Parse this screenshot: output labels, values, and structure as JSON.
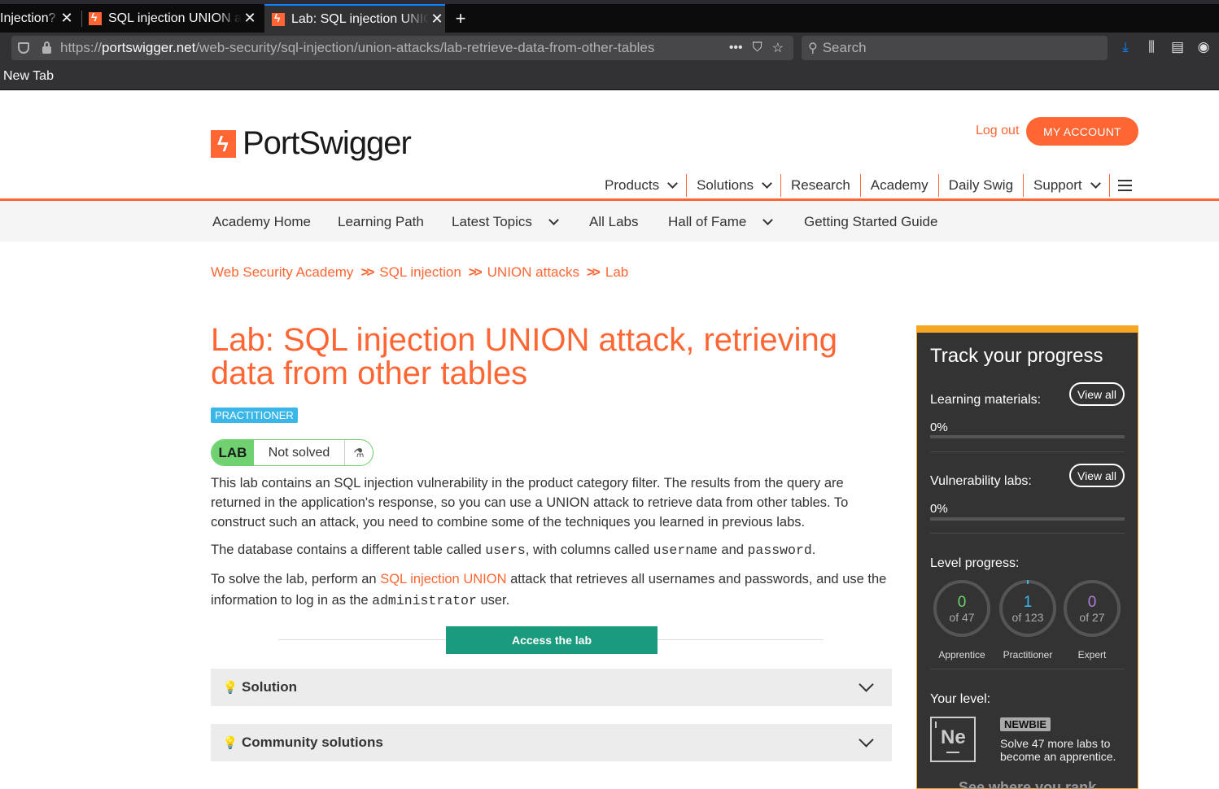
{
  "browser": {
    "tabs": [
      {
        "title": "Injection?",
        "active": false
      },
      {
        "title": "SQL injection UNION attacks",
        "active": false
      },
      {
        "title": "Lab: SQL injection UNION attack",
        "active": true
      }
    ],
    "url_scheme": "https://",
    "url_host": "portswigger.net",
    "url_path": "/web-security/sql-injection/union-attacks/lab-retrieve-data-from-other-tables",
    "search_placeholder": "Search",
    "bookmark": "New Tab"
  },
  "site": {
    "logo_text": "PortSwigger",
    "logout": "Log out",
    "my_account": "MY ACCOUNT",
    "nav": [
      "Products",
      "Solutions",
      "Research",
      "Academy",
      "Daily Swig",
      "Support"
    ],
    "subnav": [
      "Academy Home",
      "Learning Path",
      "Latest Topics",
      "All Labs",
      "Hall of Fame",
      "Getting Started Guide"
    ],
    "breadcrumbs": [
      "Web Security Academy",
      "SQL injection",
      "UNION attacks",
      "Lab"
    ],
    "breadcrumb_sep": ">>"
  },
  "lab": {
    "title": "Lab: SQL injection UNION attack, retrieving data from other tables",
    "level": "PRACTITIONER",
    "badge_label": "LAB",
    "status": "Not solved",
    "p1": "This lab contains an SQL injection vulnerability in the product category filter. The results from the query are returned in the application's response, so you can use a UNION attack to retrieve data from other tables. To construct such an attack, you need to combine some of the techniques you learned in previous labs.",
    "p2_a": "The database contains a different table called ",
    "p2_code1": "users",
    "p2_b": ", with columns called ",
    "p2_code2": "username",
    "p2_c": " and ",
    "p2_code3": "password",
    "p2_d": ".",
    "p3_a": "To solve the lab, perform an ",
    "p3_link": "SQL injection UNION",
    "p3_b": " attack that retrieves all usernames and passwords, and use the information to log in as the ",
    "p3_code": "administrator",
    "p3_c": " user.",
    "access_button": "Access the lab",
    "accordions": [
      "Solution",
      "Community solutions"
    ]
  },
  "progress": {
    "title": "Track your progress",
    "learning_label": "Learning materials:",
    "learning_pct": "0%",
    "labs_label": "Vulnerability labs:",
    "labs_pct": "0%",
    "view_all": "View all",
    "level_label": "Level progress:",
    "levels": [
      {
        "name": "Apprentice",
        "done": "0",
        "total": "of 47",
        "color": "#6ccf6c"
      },
      {
        "name": "Practitioner",
        "done": "1",
        "total": "of 123",
        "color": "#3ab7e8"
      },
      {
        "name": "Expert",
        "done": "0",
        "total": "of 27",
        "color": "#b07cd8"
      }
    ],
    "your_level_label": "Your level:",
    "element_symbol": "Ne",
    "level_name": "NEWBIE",
    "level_hint": "Solve 47 more labs to become an apprentice.",
    "rank_link": "See where you rank"
  },
  "colors": {
    "brand": "#ff6633",
    "access": "#1a9b7e",
    "practitioner": "#3ab7e8",
    "solved_green": "#70d170"
  }
}
